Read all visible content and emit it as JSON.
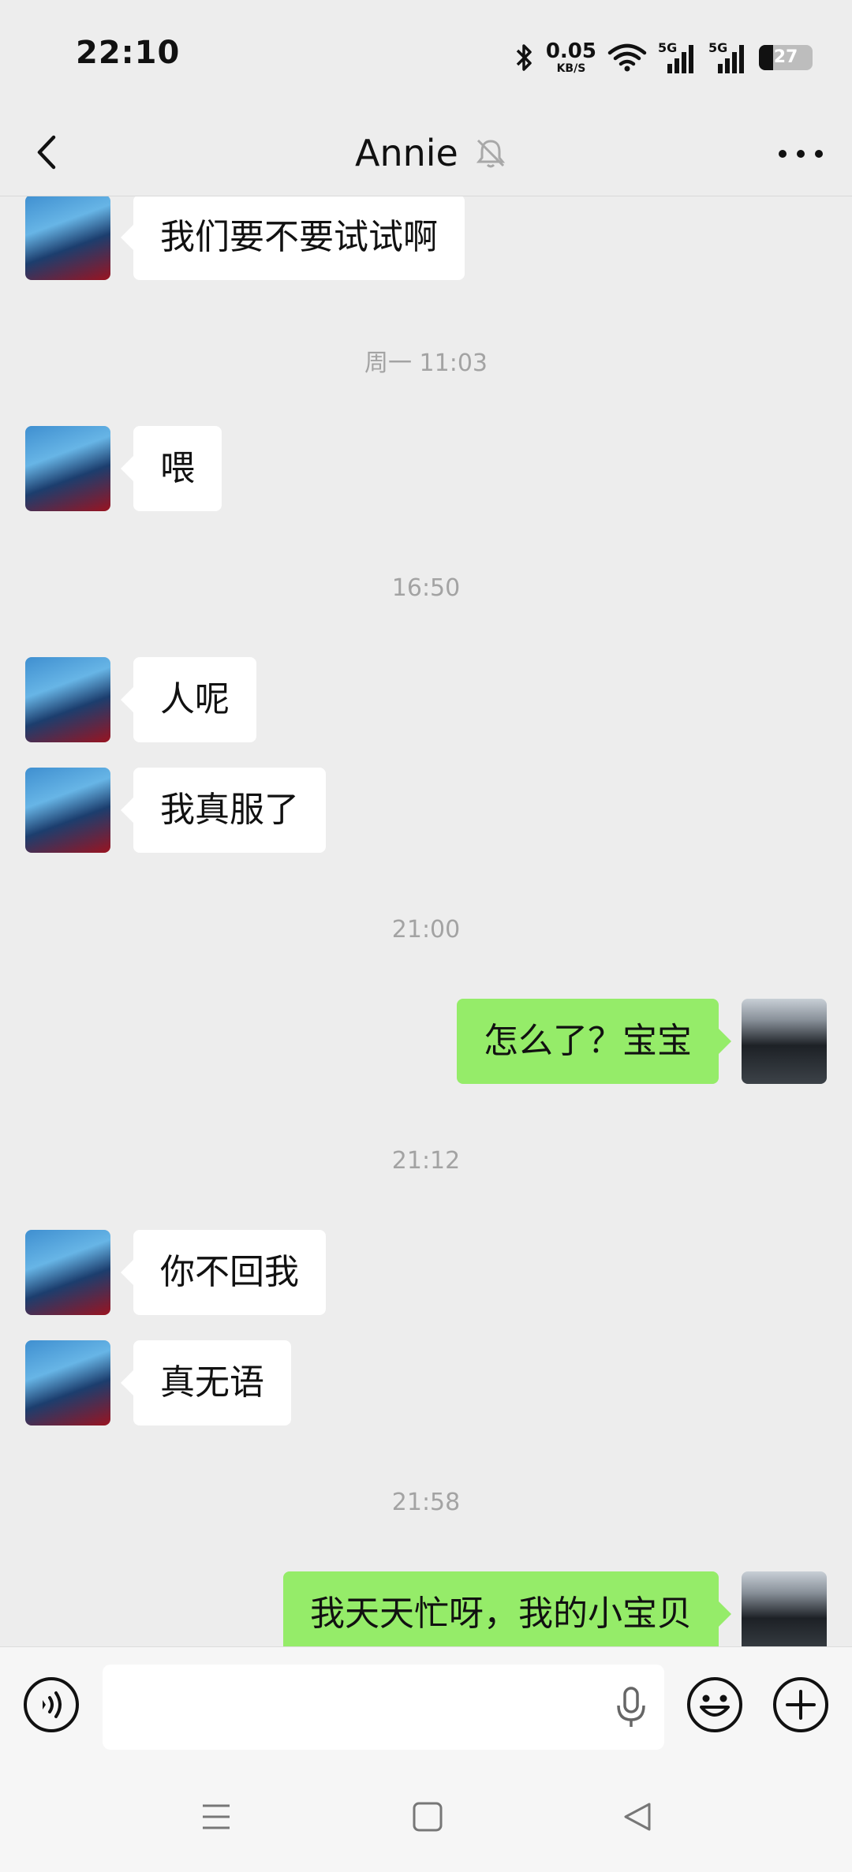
{
  "status_bar": {
    "time": "22:10",
    "net_speed_value": "0.05",
    "net_speed_unit": "KB/S",
    "signal_1_label": "5G",
    "signal_2_label": "5G",
    "battery_level": "27"
  },
  "header": {
    "title": "Annie",
    "muted": true
  },
  "chat": {
    "messages": [
      {
        "type": "msg",
        "side": "left",
        "text": "我们要不要试试啊"
      },
      {
        "type": "time",
        "text": "周一 11:03"
      },
      {
        "type": "msg",
        "side": "left",
        "text": "喂"
      },
      {
        "type": "time",
        "text": "16:50"
      },
      {
        "type": "msg",
        "side": "left",
        "text": "人呢"
      },
      {
        "type": "msg",
        "side": "left",
        "text": "我真服了"
      },
      {
        "type": "time",
        "text": "21:00"
      },
      {
        "type": "msg",
        "side": "right",
        "text": "怎么了？宝宝"
      },
      {
        "type": "time",
        "text": "21:12"
      },
      {
        "type": "msg",
        "side": "left",
        "text": "你不回我"
      },
      {
        "type": "msg",
        "side": "left",
        "text": "真无语"
      },
      {
        "type": "time",
        "text": "21:58"
      },
      {
        "type": "msg",
        "side": "right",
        "text": "我天天忙呀，我的小宝贝"
      }
    ]
  },
  "colors": {
    "background": "#ededed",
    "bubble_received": "#ffffff",
    "bubble_sent": "#95ec69",
    "timestamp": "#a3a3a3"
  },
  "icons": {
    "back": "back-arrow-icon",
    "mute": "bell-muted-icon",
    "more": "more-dots-icon",
    "voice": "voice-mode-icon",
    "mic": "microphone-icon",
    "emoji": "emoji-icon",
    "plus": "plus-icon",
    "nav_menu": "menu-icon",
    "nav_home": "home-icon",
    "nav_back": "nav-back-icon"
  }
}
